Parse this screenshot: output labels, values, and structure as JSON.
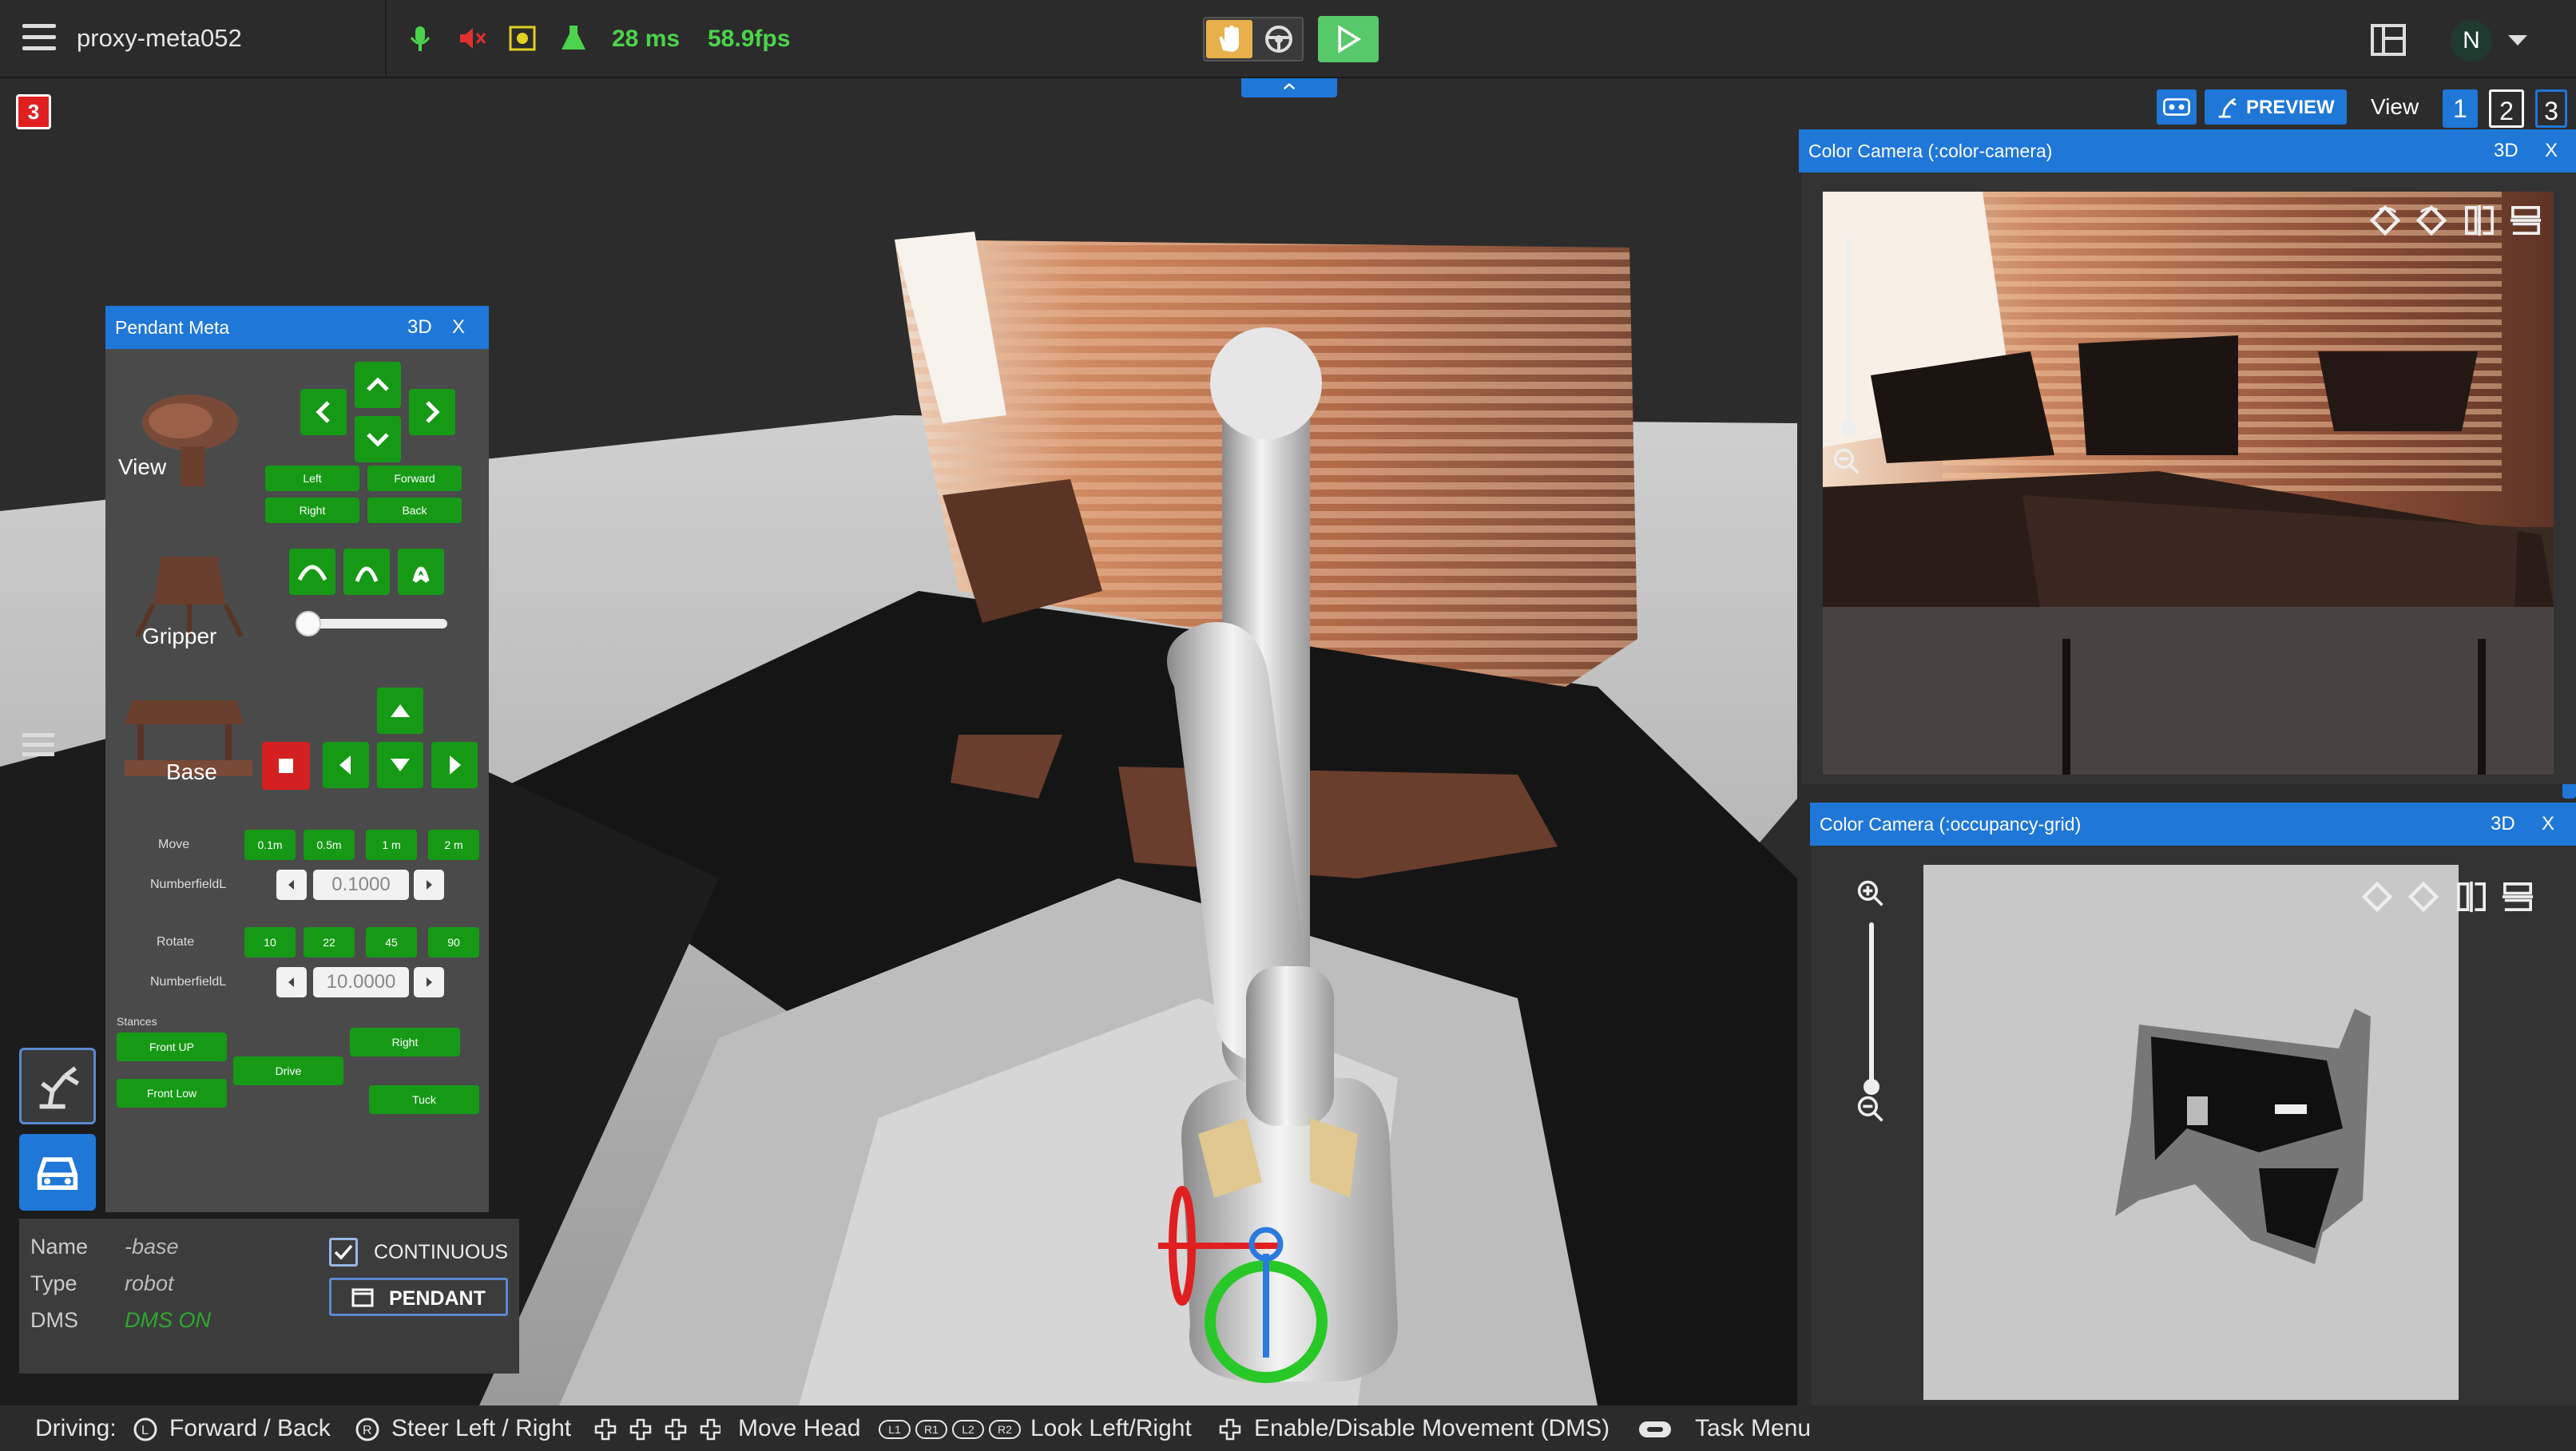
{
  "app": {
    "title": "proxy-meta052",
    "latency": "28 ms",
    "fps": "58.9fps",
    "user_initial": "N",
    "alert_count": "3"
  },
  "toolbar_right": {
    "preview_label": "PREVIEW",
    "view_label": "View",
    "views": [
      "1",
      "2",
      "3"
    ],
    "active_view": "1"
  },
  "pendant": {
    "title": "Pendant Meta",
    "mode_3d": "3D",
    "close": "X",
    "view_label": "View",
    "gripper_label": "Gripper",
    "base_label": "Base",
    "view_buttons": [
      "Left",
      "Forward",
      "Right",
      "Back"
    ],
    "move_label": "Move",
    "move_steps": [
      "0.1m",
      "0.5m",
      "1 m",
      "2 m"
    ],
    "move_field_label": "NumberfieldL",
    "move_value": "0.1000",
    "rotate_label": "Rotate",
    "rotate_steps": [
      "10",
      "22",
      "45",
      "90"
    ],
    "rotate_field_label": "NumberfieldL",
    "rotate_value": "10.0000",
    "stances_label": "Stances",
    "stances": {
      "front_up": "Front UP",
      "front_low": "Front Low",
      "drive": "Drive",
      "right": "Right",
      "tuck": "Tuck"
    }
  },
  "info": {
    "name_key": "Name",
    "name_value": "-base",
    "type_key": "Type",
    "type_value": "robot",
    "dms_key": "DMS",
    "dms_value": "DMS ON",
    "continuous_label": "CONTINUOUS",
    "pendant_button": "PENDANT"
  },
  "camera_color": {
    "title": "Color Camera (:color-camera)",
    "mode_3d": "3D",
    "close": "X"
  },
  "camera_grid": {
    "title": "Color Camera (:occupancy-grid)",
    "mode_3d": "3D",
    "close": "X"
  },
  "bottom_bar": {
    "driving_label": "Driving:",
    "forward_back": "Forward / Back",
    "steer": "Steer Left / Right",
    "move_head": "Move Head",
    "look": "Look Left/Right",
    "dms": "Enable/Disable Movement (DMS)",
    "task_menu": "Task Menu",
    "shoulder_keys": [
      "L1",
      "R1",
      "L2",
      "R2"
    ]
  },
  "colors": {
    "accent_blue": "#1f77d8",
    "status_green": "#4cd44c",
    "button_green": "#169a16",
    "stop_red": "#d42020"
  }
}
